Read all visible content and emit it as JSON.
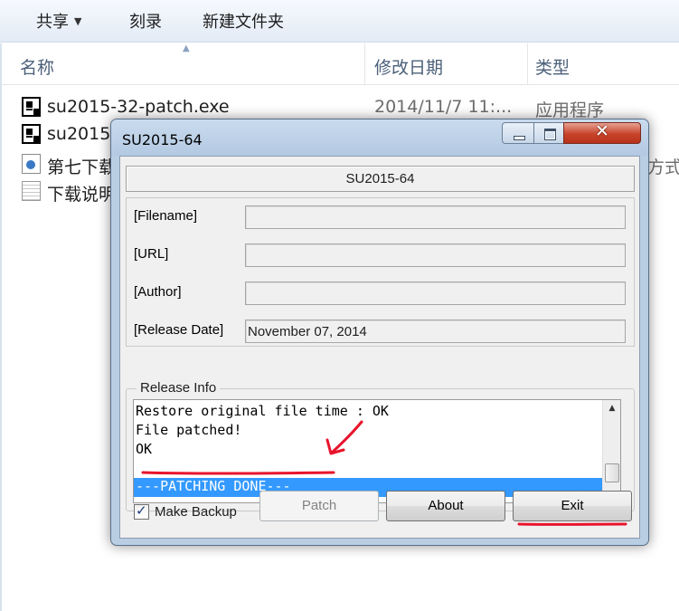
{
  "explorer": {
    "toolbar": {
      "share": "共享",
      "burn": "刻录",
      "new_folder": "新建文件夹"
    },
    "columns": {
      "name": "名称",
      "date": "修改日期",
      "type": "类型"
    },
    "files": [
      {
        "name": "su2015-32-patch.exe",
        "date": "2014/11/7 11:...",
        "type": "应用程序",
        "icon": "exe-icon"
      },
      {
        "name": "su2015",
        "date": "",
        "type": "",
        "icon": "exe-icon"
      },
      {
        "name": "第七下载",
        "date": "",
        "type": "方式",
        "icon": "shortcut-icon"
      },
      {
        "name": "下载说明",
        "date": "",
        "type": "",
        "icon": "text-file-icon"
      }
    ]
  },
  "dialog": {
    "title": "SU2015-64",
    "banner": "SU2015-64",
    "fields": [
      {
        "label": "[Filename]",
        "value": ""
      },
      {
        "label": "[URL]",
        "value": ""
      },
      {
        "label": "[Author]",
        "value": ""
      },
      {
        "label": "[Release Date]",
        "value": "November 07, 2014"
      }
    ],
    "release_info_title": "Release Info",
    "log": [
      "Restore original file time : OK",
      "File patched!",
      "OK",
      "",
      "---PATCHING DONE---"
    ],
    "make_backup_label": "Make Backup",
    "make_backup_checked": true,
    "buttons": {
      "patch": "Patch",
      "about": "About",
      "exit": "Exit"
    }
  },
  "colors": {
    "selection": "#3399ff",
    "annotation": "#e8142c",
    "close_button": "#c6442b"
  }
}
